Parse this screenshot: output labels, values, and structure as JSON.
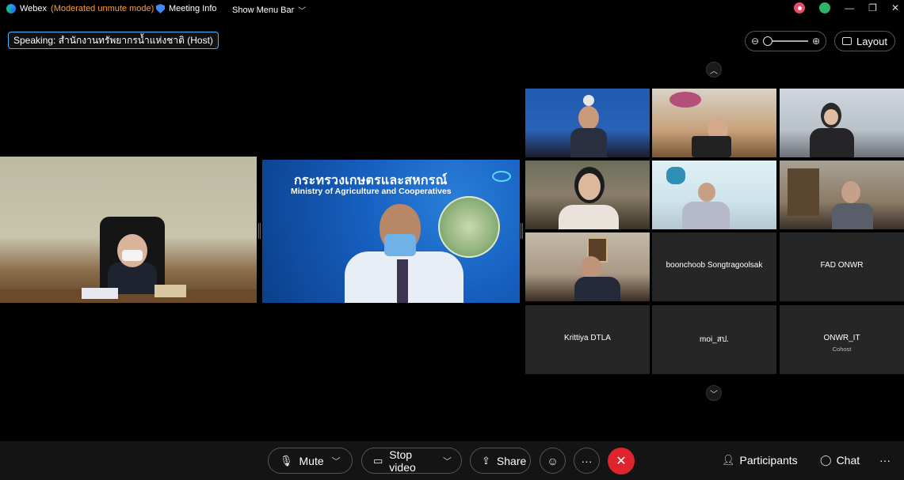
{
  "titlebar": {
    "app_name": "Webex",
    "mode": "(Moderated unmute mode)",
    "meeting_info": "Meeting Info",
    "menu_bar": "Show Menu Bar",
    "minimize": "—",
    "restore": "❐",
    "close": "✕"
  },
  "speaking": "Speaking: สำนักงานทรัพยากรน้ำแห่งชาติ (Host)",
  "layout_label": "Layout",
  "stage": {
    "slide_thai": "กระทรวงเกษตรและสหกรณ์",
    "slide_eng": "Ministry of Agriculture and Cooperatives"
  },
  "participants_grid": [
    {
      "name": "",
      "role": "",
      "video": true
    },
    {
      "name": "",
      "role": "",
      "video": true
    },
    {
      "name": "",
      "role": "",
      "video": true
    },
    {
      "name": "",
      "role": "",
      "video": true
    },
    {
      "name": "",
      "role": "",
      "video": true
    },
    {
      "name": "",
      "role": "",
      "video": true
    },
    {
      "name": "",
      "role": "",
      "video": true
    },
    {
      "name": "boonchoob Songtragoolsak",
      "role": "",
      "video": false
    },
    {
      "name": "FAD ONWR",
      "role": "",
      "video": false
    },
    {
      "name": "Krittiya DTLA",
      "role": "",
      "video": false
    },
    {
      "name": "moi_สป.",
      "role": "",
      "video": false
    },
    {
      "name": "ONWR_IT",
      "role": "Cohost",
      "video": false
    }
  ],
  "toolbar": {
    "mute": "Mute",
    "stop_video": "Stop video",
    "share": "Share",
    "participants": "Participants",
    "chat": "Chat",
    "more": "···"
  },
  "colors": {
    "accent": "#4ab3ff",
    "mode_text": "#ff9a2e",
    "leave": "#e0242e",
    "tile": "#262626"
  }
}
